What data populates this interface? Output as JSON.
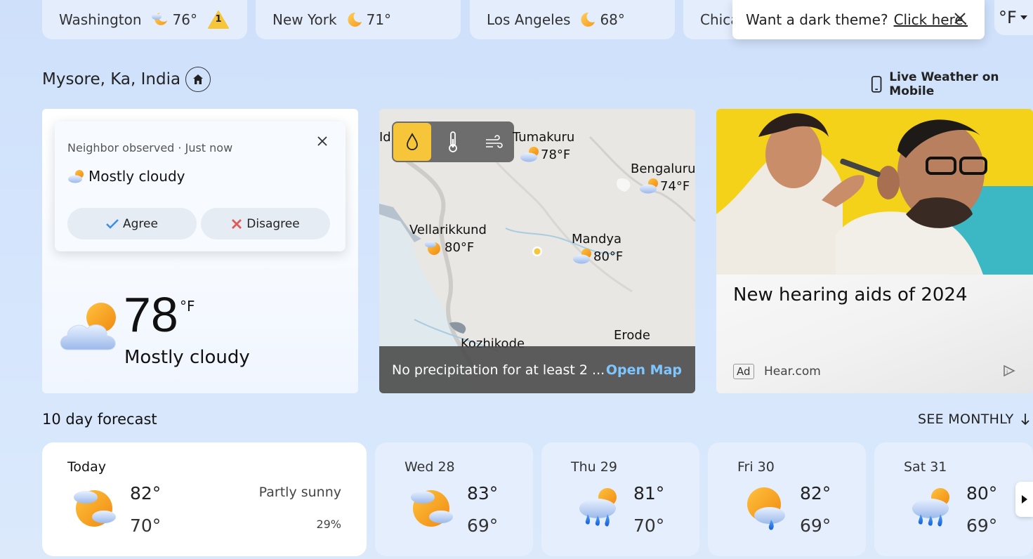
{
  "cities": [
    {
      "name": "Washington",
      "temp": "76°",
      "icon": "moon-cloud-icon",
      "alert_count": "1"
    },
    {
      "name": "New York",
      "temp": "71°",
      "icon": "moon-icon"
    },
    {
      "name": "Los Angeles",
      "temp": "68°",
      "icon": "moon-icon"
    },
    {
      "name": "Chica"
    }
  ],
  "toast": {
    "text": "Want a dark theme?",
    "link": "Click here."
  },
  "unit_toggle": "°F",
  "location": "Mysore, Ka, India",
  "mobile_link": "Live Weather on Mobile",
  "observation": {
    "header": "Neighbor observed · Just now",
    "condition": "Mostly cloudy",
    "agree": "Agree",
    "disagree": "Disagree"
  },
  "current": {
    "temp": "78",
    "unit": "°F",
    "condition": "Mostly cloudy"
  },
  "map": {
    "labels": [
      {
        "name": "Idu",
        "temp": ""
      },
      {
        "name": "Tumakuru",
        "temp": "78°F"
      },
      {
        "name": "Bengaluru",
        "temp": "74°F"
      },
      {
        "name": "Vellarikkund",
        "temp": "80°F"
      },
      {
        "name": "Mandya",
        "temp": "80°F"
      },
      {
        "name": "Erode",
        "temp": ""
      },
      {
        "name": "Kozhikode",
        "temp": ""
      }
    ],
    "summary": "No precipitation for at least 2 ...",
    "open_map": "Open Map"
  },
  "ad": {
    "title": "New hearing aids of 2024",
    "tag": "Ad",
    "source": "Hear.com"
  },
  "forecast": {
    "title": "10 day forecast",
    "see_monthly": "SEE MONTHLY",
    "days": [
      {
        "name": "Today",
        "hi": "82°",
        "lo": "70°",
        "summary": "Partly sunny",
        "precip": "29%",
        "icon": "partly-sunny-icon"
      },
      {
        "name": "Wed 28",
        "hi": "83°",
        "lo": "69°",
        "icon": "partly-sunny-icon"
      },
      {
        "name": "Thu 29",
        "hi": "81°",
        "lo": "70°",
        "icon": "rain-showers-icon"
      },
      {
        "name": "Fri 30",
        "hi": "82°",
        "lo": "69°",
        "icon": "sun-shower-icon"
      },
      {
        "name": "Sat 31",
        "hi": "80°",
        "lo": "69°",
        "icon": "rain-showers-icon"
      }
    ]
  },
  "colors": {
    "background": "#d6e6fc",
    "pill": "#e3edfc",
    "accent_yellow": "#f6c53a",
    "link_blue": "#7fc6ff"
  }
}
